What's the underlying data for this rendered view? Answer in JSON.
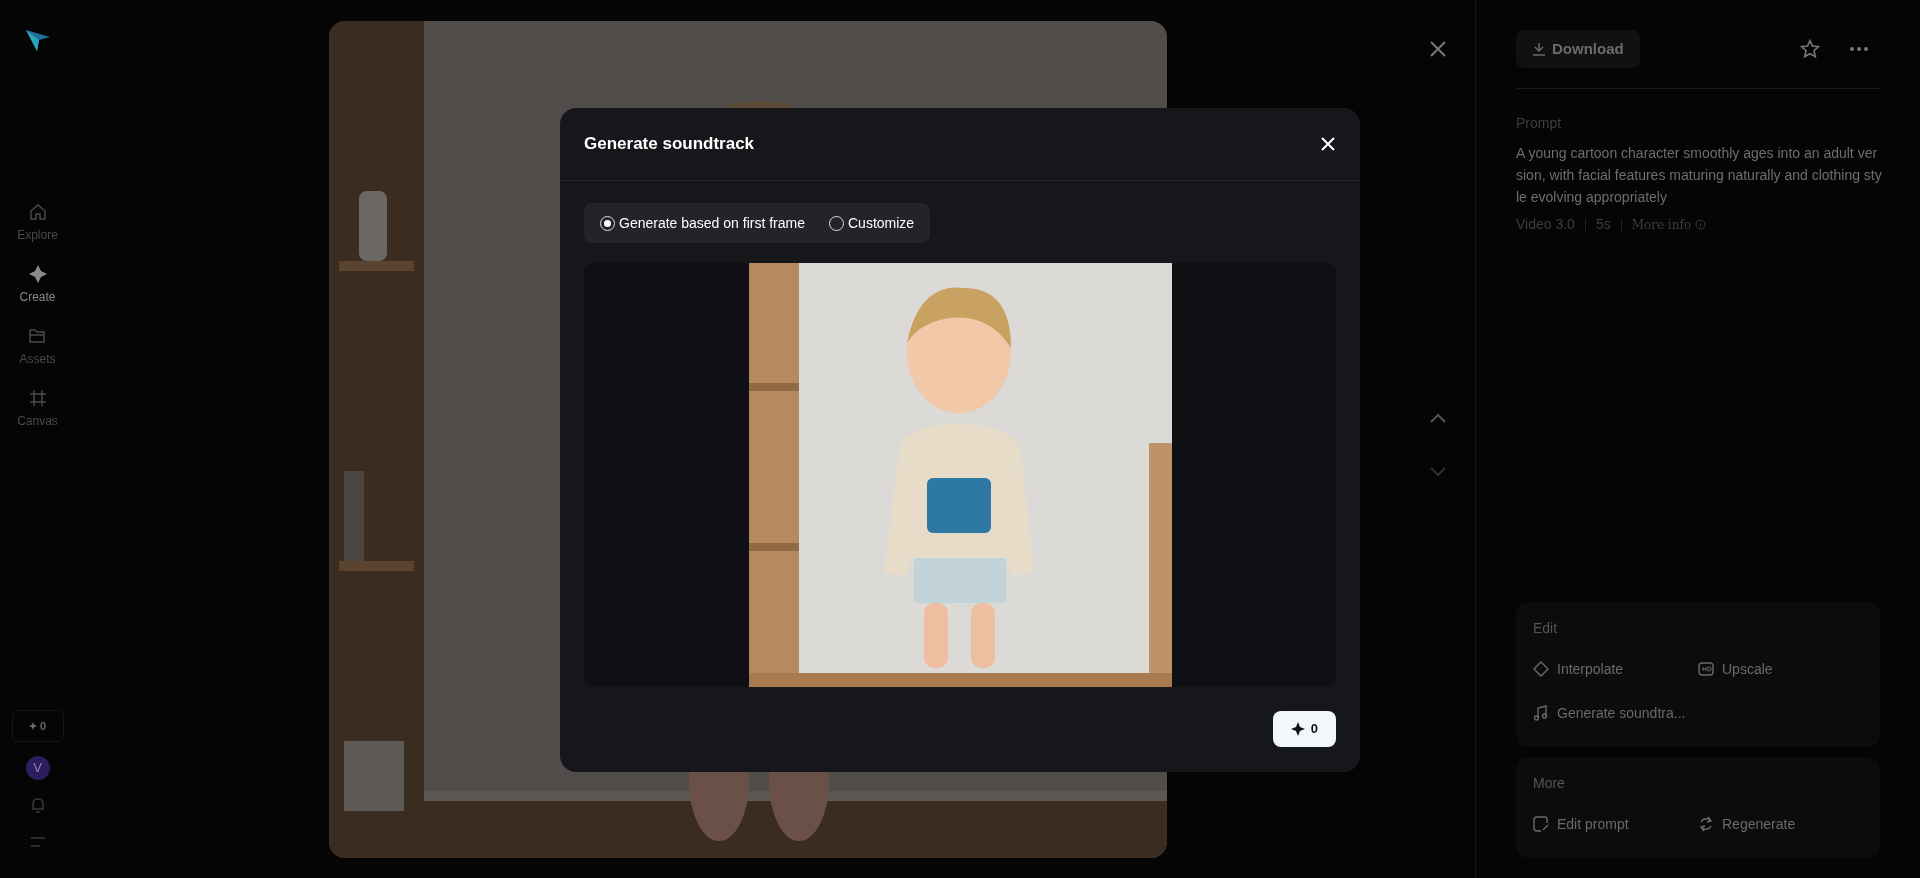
{
  "sidebar": {
    "nav": [
      {
        "label": "Explore",
        "selected": false
      },
      {
        "label": "Create",
        "selected": true
      },
      {
        "label": "Assets",
        "selected": false
      },
      {
        "label": "Canvas",
        "selected": false
      }
    ],
    "credits": "0",
    "avatar": "V"
  },
  "panel": {
    "download": "Download",
    "prompt_label": "Prompt",
    "prompt": "A young cartoon character smoothly ages into an adult version, with facial features maturing naturally and clothing style evolving appropriately",
    "meta": [
      "Video 3.0",
      "5s",
      "More info"
    ],
    "sections": [
      {
        "title": "Edit",
        "actions": [
          {
            "label": "Interpolate"
          },
          {
            "label": "Upscale"
          },
          {
            "label": "Generate soundtra..."
          }
        ]
      },
      {
        "title": "More",
        "actions": [
          {
            "label": "Edit prompt"
          },
          {
            "label": "Regenerate"
          }
        ]
      }
    ]
  },
  "dialog": {
    "title": "Generate soundtrack",
    "options": [
      {
        "label": "Generate based on first frame",
        "selected": true
      },
      {
        "label": "Customize",
        "selected": false
      }
    ],
    "credits": "0"
  }
}
